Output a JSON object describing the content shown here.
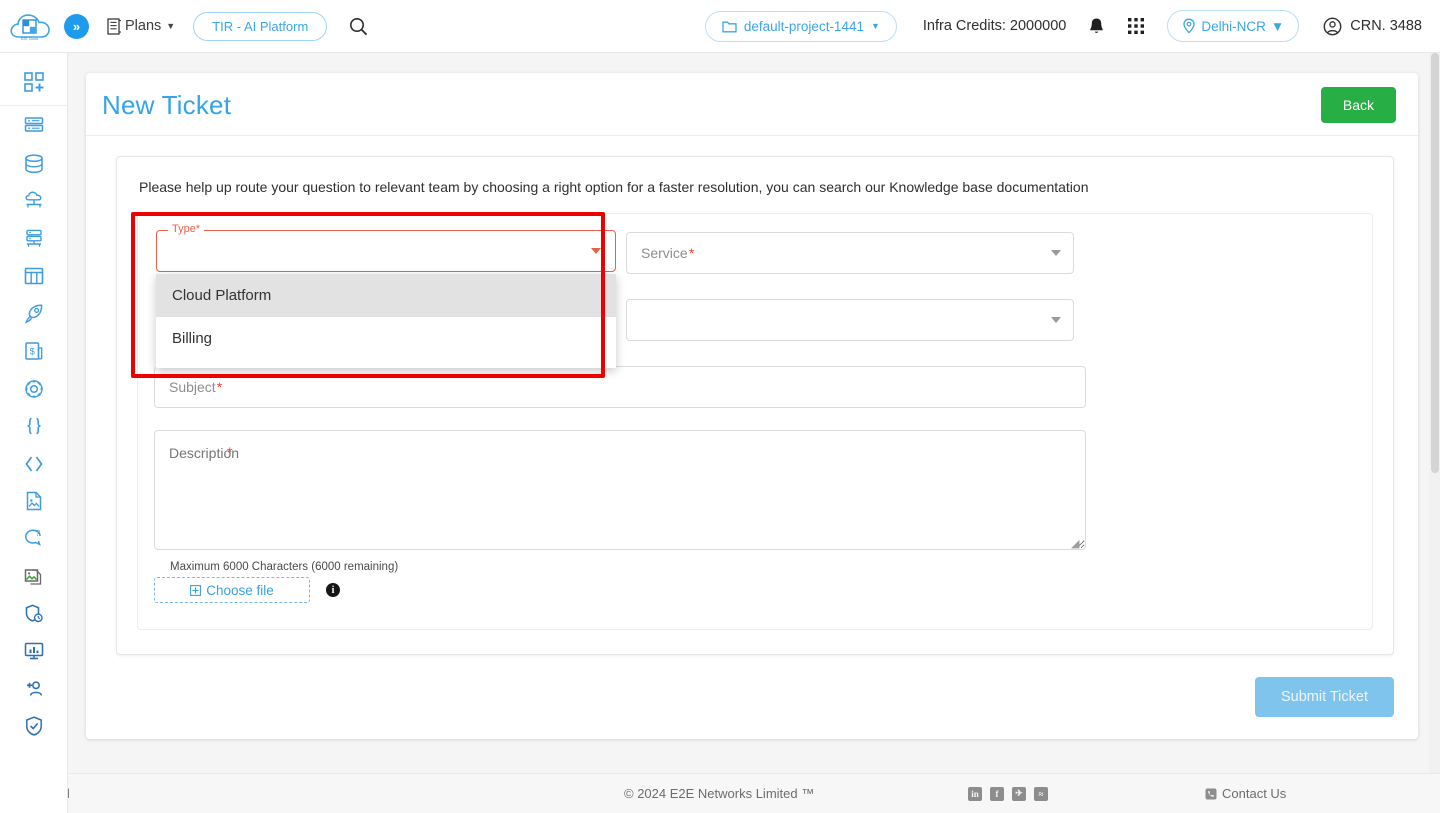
{
  "header": {
    "logo_label": "E2E Cloud",
    "expand_icon": "chevron-double-right-icon",
    "plans_label": "Plans",
    "plans_icon": "list-icon",
    "tir_label": "TIR - AI Platform",
    "search_icon": "search-icon",
    "project_label": "default-project-1441",
    "project_icon": "folder-icon",
    "credits_label": "Infra Credits: 2000000",
    "bell_icon": "notification-bell-icon",
    "apps_icon": "app-grid-icon",
    "region_label": "Delhi-NCR",
    "region_icon": "location-pin-icon",
    "account_label": "CRN. 3488",
    "account_icon": "user-circle-icon"
  },
  "sidebar": {
    "items": [
      {
        "name": "dashboard-add",
        "icon": "grid-plus-icon"
      },
      {
        "name": "compute-nodes",
        "icon": "server-icon"
      },
      {
        "name": "database",
        "icon": "database-icon"
      },
      {
        "name": "cloud-network",
        "icon": "cloud-network-icon"
      },
      {
        "name": "bare-metal",
        "icon": "server-network-icon"
      },
      {
        "name": "kubernetes",
        "icon": "panels-icon"
      },
      {
        "name": "launch",
        "icon": "rocket-icon"
      },
      {
        "name": "billing",
        "icon": "invoice-dollar-icon"
      },
      {
        "name": "settings",
        "icon": "gear-icon"
      },
      {
        "name": "api",
        "icon": "braces-icon"
      },
      {
        "name": "code",
        "icon": "angle-brackets-icon"
      },
      {
        "name": "documents",
        "icon": "file-image-icon"
      },
      {
        "name": "support",
        "icon": "chat-question-icon"
      },
      {
        "name": "images",
        "icon": "picture-icon"
      },
      {
        "name": "security-shield",
        "icon": "shield-clock-icon"
      },
      {
        "name": "monitoring",
        "icon": "monitor-chart-icon"
      },
      {
        "name": "add-user",
        "icon": "user-plus-icon"
      },
      {
        "name": "protection",
        "icon": "shield-check-icon"
      }
    ]
  },
  "page": {
    "title": "New Ticket",
    "back_label": "Back",
    "intro": "Please help up route your question to relevant team by choosing a right option for a faster resolution, you can search our Knowledge base documentation"
  },
  "form": {
    "type": {
      "legend": "Type",
      "required_mark": "*",
      "value": "",
      "dropdown_icon": "chevron-down-icon",
      "options": [
        {
          "label": "Cloud Platform",
          "highlighted": true
        },
        {
          "label": "Billing",
          "highlighted": false
        }
      ]
    },
    "service": {
      "placeholder": "Service",
      "required_mark": "*",
      "value": "",
      "dropdown_icon": "chevron-down-icon"
    },
    "secondary_select": {
      "placeholder": "",
      "value": "",
      "dropdown_icon": "chevron-down-icon"
    },
    "subject": {
      "placeholder": "Subject",
      "required_mark": "*",
      "value": ""
    },
    "description": {
      "placeholder": "Description",
      "required_mark": "*",
      "value": "",
      "char_hint": "Maximum 6000 Characters (6000 remaining)"
    },
    "attachment": {
      "choose_file_label": "Choose file",
      "plus_icon": "plus-square-icon",
      "info_icon": "info-circle-icon"
    },
    "submit_label": "Submit Ticket"
  },
  "footer": {
    "legal": "Legal",
    "copyright": "© 2024 E2E Networks Limited ™",
    "social": [
      {
        "name": "linkedin-icon",
        "glyph": "in"
      },
      {
        "name": "facebook-icon",
        "glyph": "f"
      },
      {
        "name": "twitter-icon",
        "glyph": "t"
      },
      {
        "name": "rss-icon",
        "glyph": "r"
      }
    ],
    "contact_label": "Contact Us",
    "contact_icon": "phone-icon"
  },
  "colors": {
    "accent_blue": "#36a4e8",
    "back_green": "#27ae44",
    "error_red": "#e8604c",
    "highlight_box": "#ee0000",
    "submit_disabled": "#7fc4ec"
  }
}
